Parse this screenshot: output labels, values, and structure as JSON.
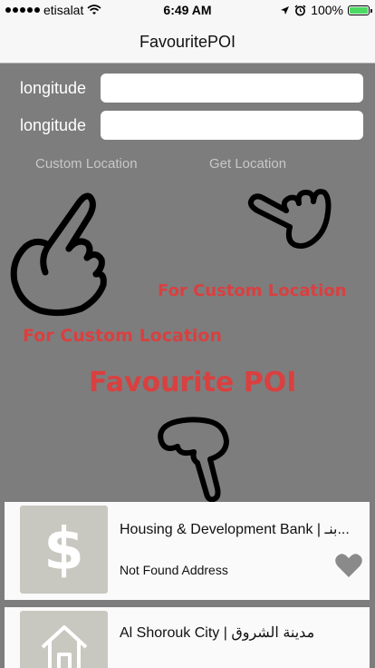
{
  "status_bar": {
    "carrier": "etisalat",
    "time": "6:49 AM",
    "battery_percent": "100%",
    "battery_level": 1.0,
    "battery_color": "#4cd964",
    "icons": [
      "signal-dots-icon",
      "wifi-icon",
      "location-arrow-icon",
      "alarm-icon",
      "battery-icon"
    ]
  },
  "nav": {
    "title": "FavouritePOI"
  },
  "form": {
    "field1_label": "longitude",
    "field1_value": "",
    "field2_label": "longitude",
    "field2_value": ""
  },
  "buttons": {
    "custom_location": "Custom Location",
    "get_location": "Get Location"
  },
  "hints": {
    "for_custom_location_1": "For Custom Location",
    "for_custom_location_2": "For Custom Location",
    "favourite_poi": "Favourite POI",
    "accent_color": "#d94040"
  },
  "cards": [
    {
      "title": "Housing & Development Bank | بنـ...",
      "subtitle": "Not Found Address",
      "icon": "dollar-icon"
    },
    {
      "title": "Al Shorouk City | مدينة الشروق",
      "icon": "building-icon"
    }
  ],
  "colors": {
    "background": "#7d7d7d",
    "bar": "#f7f7f7",
    "thumb": "#c8c7c0",
    "heart": "#8a8a8a"
  }
}
